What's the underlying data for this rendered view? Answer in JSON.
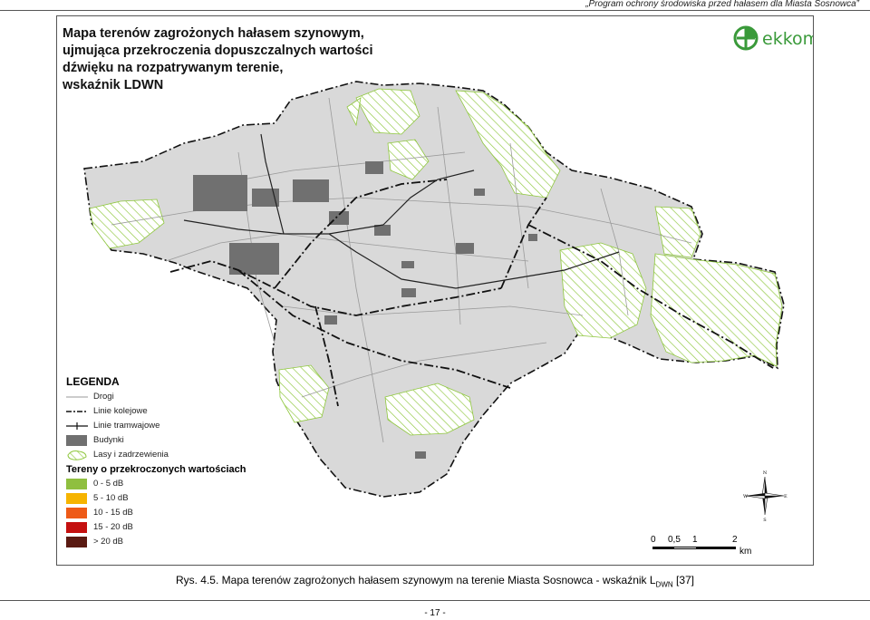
{
  "header": {
    "text": "„Program ochrony środowiska przed hałasem dla Miasta Sosnowca”"
  },
  "map": {
    "title": "Mapa terenów zagrożonych hałasem szynowym,\nujmująca przekroczenia dopuszczalnych wartości\ndźwięku na rozpatrywanym terenie,\nwskaźnik LDWN",
    "logo": {
      "text": "ekkom",
      "icon": "ekkom-leaf-logo"
    },
    "legend": {
      "title": "LEGENDA",
      "items": [
        {
          "label": "Drogi",
          "icon": "road-line"
        },
        {
          "label": "Linie kolejowe",
          "icon": "railway-dash-line"
        },
        {
          "label": "Linie tramwajowe",
          "icon": "tram-line"
        },
        {
          "label": "Budynki",
          "icon": "building-fill"
        },
        {
          "label": "Lasy i zadrzewienia",
          "icon": "forest-hatch"
        }
      ],
      "subtitle": "Tereny o przekroczonych wartościach",
      "classes": [
        {
          "label": "0 - 5 dB",
          "color": "#8fbf3f"
        },
        {
          "label": "5 - 10 dB",
          "color": "#f6b400"
        },
        {
          "label": "10 - 15 dB",
          "color": "#ee5a17"
        },
        {
          "label": "15 - 20 dB",
          "color": "#c4100f"
        },
        {
          "label": "> 20 dB",
          "color": "#5a1a12"
        }
      ]
    },
    "compass": {
      "n": "N",
      "s": "S",
      "e": "E",
      "w": "W"
    },
    "scale": {
      "ticks": [
        "0",
        "0,5",
        "1",
        "2"
      ],
      "unit": "km"
    },
    "colors": {
      "land": "#d9d9d9",
      "forest": "#8fc73e",
      "building": "#707070",
      "border": "#111111"
    }
  },
  "caption": {
    "prefix": "Rys. 4.5. Mapa terenów zagrożonych hałasem szynowym na terenie Miasta Sosnowca - wskaźnik L",
    "sub": "DWN",
    "suffix": " [37]"
  },
  "page_number": "- 17 -"
}
